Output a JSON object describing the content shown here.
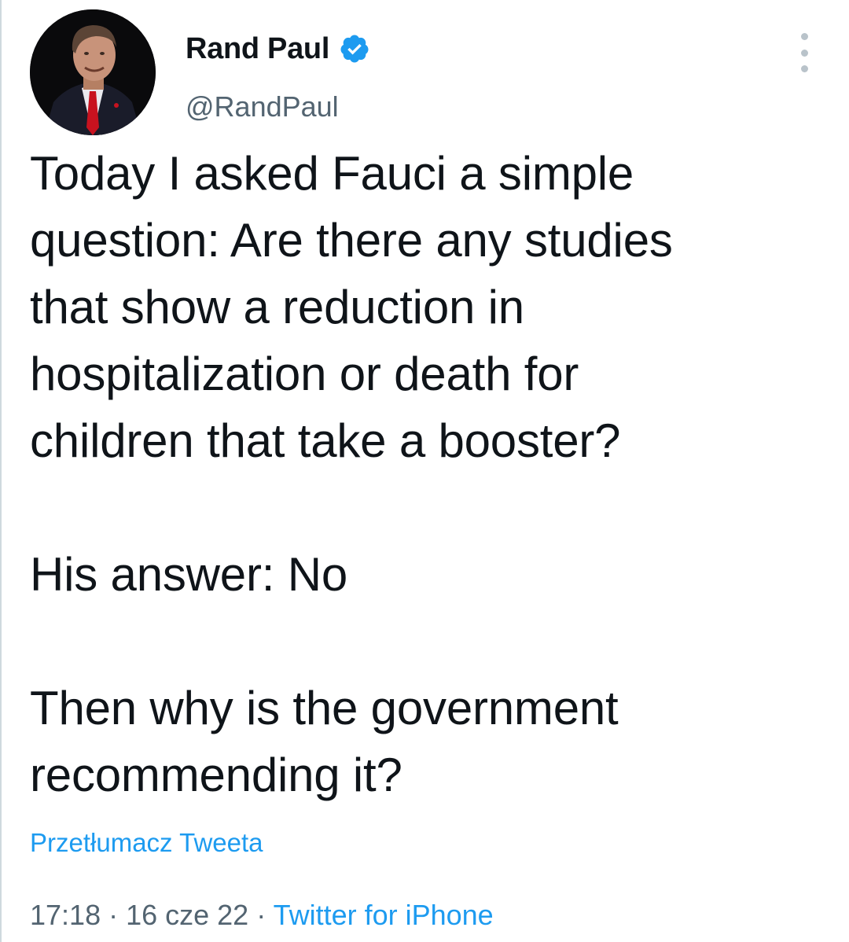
{
  "author": {
    "display_name": "Rand Paul",
    "handle": "@RandPaul",
    "verified": true,
    "avatar_icon": "profile-photo"
  },
  "icons": {
    "verified": "verified-badge-icon",
    "more": "more-options-icon"
  },
  "tweet": {
    "text": "Today I asked Fauci a simple\nquestion: Are there any studies\nthat show a reduction in\nhospitalization or death for\nchildren that take a booster?\n\nHis answer: No\n\nThen why is the government\nrecommending it?"
  },
  "translate_link": "Przetłumacz Tweeta",
  "meta": {
    "time": "17:18",
    "separator": " · ",
    "date": "16 cze 22",
    "source": "Twitter for iPhone"
  },
  "colors": {
    "accent": "#1d9bf0",
    "text": "#0f1419",
    "secondary": "#536471"
  }
}
